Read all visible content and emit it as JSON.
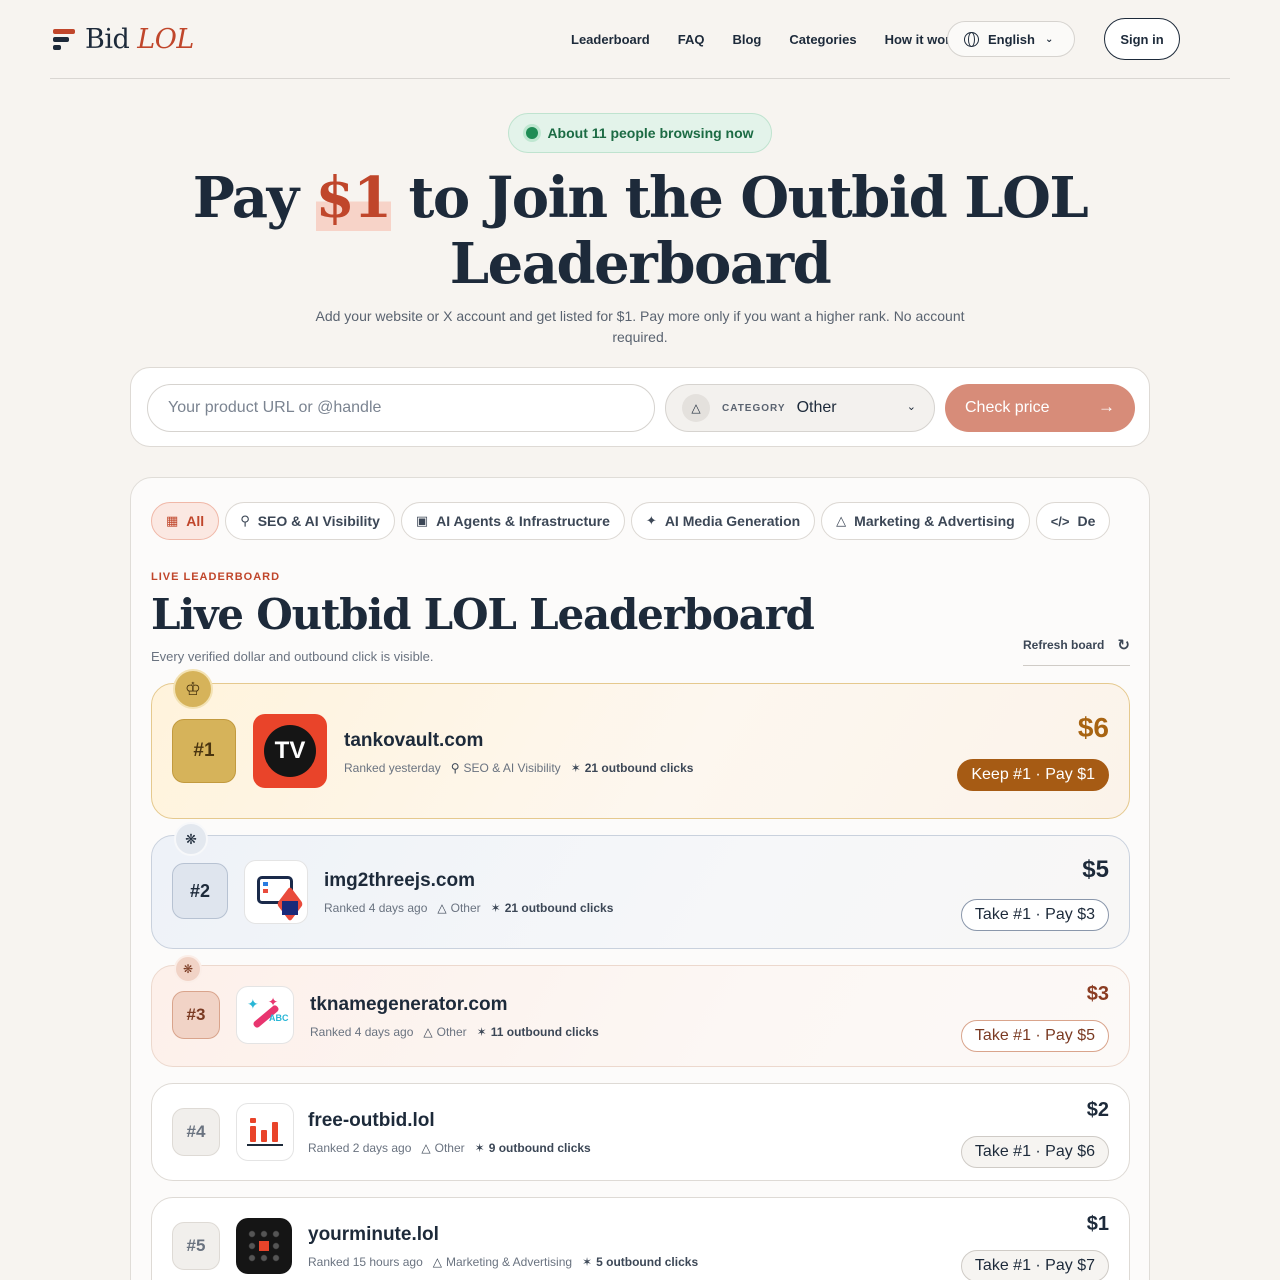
{
  "brand": {
    "name": "Bid",
    "name_accent": "LOL"
  },
  "nav": {
    "items": [
      "Leaderboard",
      "FAQ",
      "Blog",
      "Categories",
      "How it works"
    ],
    "language": "English",
    "signin": "Sign in"
  },
  "hero": {
    "browsing": "About 11 people browsing now",
    "title_pre": "Pay ",
    "title_highlight": "$1",
    "title_post": " to Join the Outbid LOL Leaderboard",
    "subtitle": "Add your website or X account and get listed for $1. Pay more only if you want a higher rank. No account required."
  },
  "form": {
    "url_placeholder": "Your product URL or @handle",
    "category_label": "CATEGORY",
    "category_value": "Other",
    "submit_label": "Check price"
  },
  "board": {
    "tabs": [
      "All",
      "SEO & AI Visibility",
      "AI Agents & Infrastructure",
      "AI Media Generation",
      "Marketing & Advertising",
      "De"
    ],
    "eyebrow": "LIVE LEADERBOARD",
    "title": "Live Outbid LOL Leaderboard",
    "subtitle": "Every verified dollar and outbound click is visible.",
    "refresh": "Refresh board",
    "rows": [
      {
        "rank": "#1",
        "domain": "tankovault.com",
        "ranked": "Ranked yesterday",
        "category": "SEO & AI Visibility",
        "clicks": "21 outbound clicks",
        "price": "$6",
        "action": "Keep #1 · Pay $1",
        "logo_text": "TV"
      },
      {
        "rank": "#2",
        "domain": "img2threejs.com",
        "ranked": "Ranked 4 days ago",
        "category": "Other",
        "clicks": "21 outbound clicks",
        "price": "$5",
        "action": "Take #1 · Pay $3"
      },
      {
        "rank": "#3",
        "domain": "tknamegenerator.com",
        "ranked": "Ranked 4 days ago",
        "category": "Other",
        "clicks": "11 outbound clicks",
        "price": "$3",
        "action": "Take #1 · Pay $5"
      },
      {
        "rank": "#4",
        "domain": "free-outbid.lol",
        "ranked": "Ranked 2 days ago",
        "category": "Other",
        "clicks": "9 outbound clicks",
        "price": "$2",
        "action": "Take #1 · Pay $6"
      },
      {
        "rank": "#5",
        "domain": "yourminute.lol",
        "ranked": "Ranked 15 hours ago",
        "category": "Marketing & Advertising",
        "clicks": "5 outbound clicks",
        "price": "$1",
        "action": "Take #1 · Pay $7"
      }
    ]
  },
  "colors": {
    "accent": "#c0462b",
    "navy": "#1d2a3a",
    "gold": "#a86412",
    "green": "#1f8c55"
  }
}
